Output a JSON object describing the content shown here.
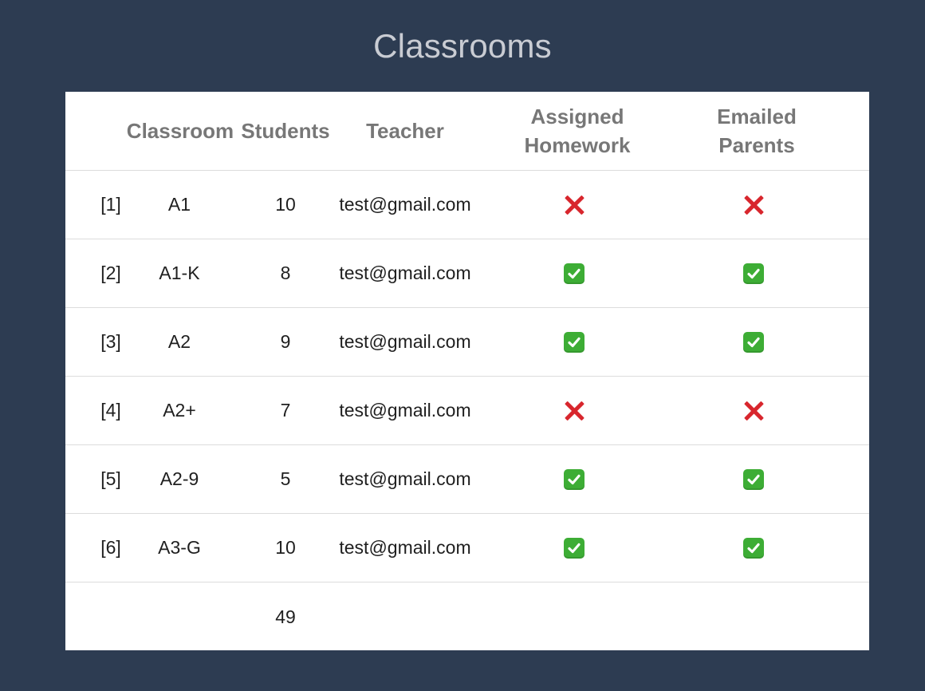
{
  "page": {
    "title": "Classrooms"
  },
  "table": {
    "headers": {
      "classroom": "Classroom",
      "students": "Students",
      "teacher": "Teacher",
      "assigned_homework_line1": "Assigned",
      "assigned_homework_line2": "Homework",
      "emailed_parents_line1": "Emailed",
      "emailed_parents_line2": "Parents"
    },
    "rows": [
      {
        "index": "[1]",
        "classroom": "A1",
        "students": "10",
        "teacher": "test@gmail.com",
        "assigned_homework": "cross-mark-icon",
        "emailed_parents": "cross-mark-icon"
      },
      {
        "index": "[2]",
        "classroom": "A1-K",
        "students": "8",
        "teacher": "test@gmail.com",
        "assigned_homework": "check-mark-icon",
        "emailed_parents": "check-mark-icon"
      },
      {
        "index": "[3]",
        "classroom": "A2",
        "students": "9",
        "teacher": "test@gmail.com",
        "assigned_homework": "check-mark-icon",
        "emailed_parents": "check-mark-icon"
      },
      {
        "index": "[4]",
        "classroom": "A2+",
        "students": "7",
        "teacher": "test@gmail.com",
        "assigned_homework": "cross-mark-icon",
        "emailed_parents": "cross-mark-icon"
      },
      {
        "index": "[5]",
        "classroom": "A2-9",
        "students": "5",
        "teacher": "test@gmail.com",
        "assigned_homework": "check-mark-icon",
        "emailed_parents": "check-mark-icon"
      },
      {
        "index": "[6]",
        "classroom": "A3-G",
        "students": "10",
        "teacher": "test@gmail.com",
        "assigned_homework": "check-mark-icon",
        "emailed_parents": "check-mark-icon"
      }
    ],
    "footer": {
      "students_total": "49"
    }
  },
  "colors": {
    "background": "#2d3c52",
    "title": "#c9ccd3",
    "header_text": "#777777",
    "cross": "#d8262d",
    "check": "#3dad35"
  }
}
